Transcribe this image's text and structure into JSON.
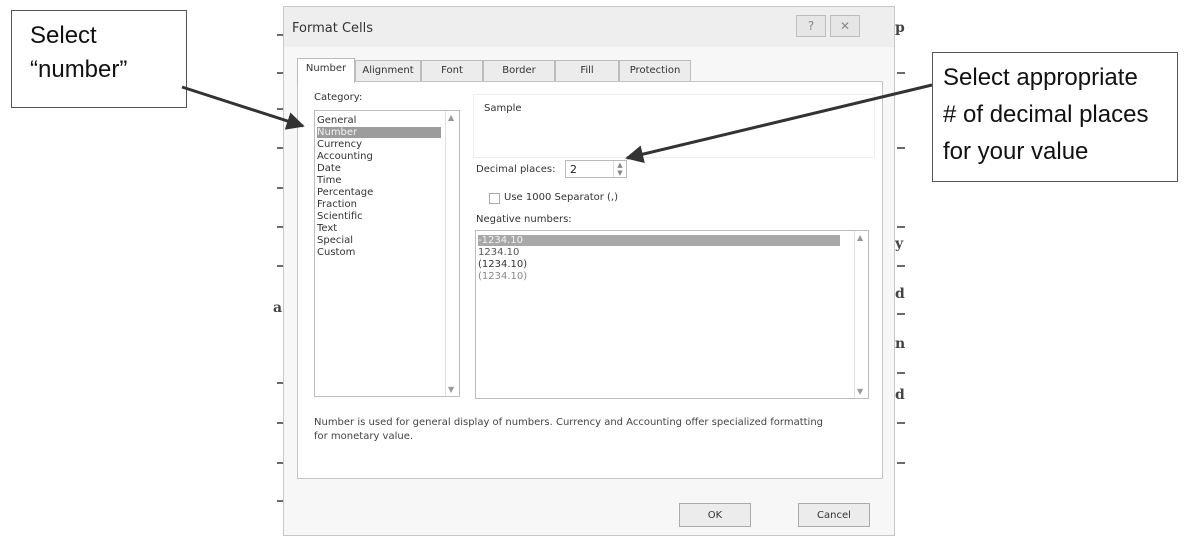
{
  "callouts": {
    "left_lines": [
      "Select",
      "“number”"
    ],
    "right_lines": [
      "Select appropriate",
      "# of decimal places",
      "for your value"
    ]
  },
  "dialog": {
    "title": "Format Cells",
    "help_button": "?",
    "close_button": "✕",
    "tabs": [
      "Number",
      "Alignment",
      "Font",
      "Border",
      "Fill",
      "Protection"
    ],
    "active_tab": "Number",
    "category_label": "Category:",
    "categories": [
      "General",
      "Number",
      "Currency",
      "Accounting",
      "Date",
      "Time",
      "Percentage",
      "Fraction",
      "Scientific",
      "Text",
      "Special",
      "Custom"
    ],
    "selected_category": "Number",
    "sample_label": "Sample",
    "decimal_places_label": "Decimal places:",
    "decimal_places_value": "2",
    "separator_label": "Use 1000 Separator (,)",
    "separator_checked": false,
    "negative_label": "Negative numbers:",
    "negative_options": [
      "-1234.10",
      "1234.10",
      "(1234.10)",
      "(1234.10)"
    ],
    "selected_negative": "-1234.10",
    "description_line1": "Number is used for general display of numbers.  Currency and Accounting offer specialized formatting",
    "description_line2": "for monetary value.",
    "ok_label": "OK",
    "cancel_label": "Cancel"
  },
  "background_glyphs": [
    "p",
    "y",
    "d",
    "n",
    "d",
    "a"
  ]
}
